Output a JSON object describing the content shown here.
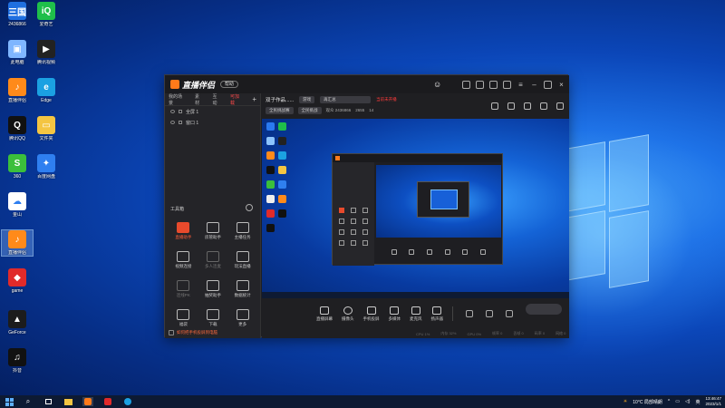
{
  "desktop": {
    "icons": [
      {
        "label": "2436866",
        "name": "desk-icon-app1",
        "color": "#1f6fe0",
        "glyph": "三国"
      },
      {
        "label": "爱奇艺",
        "name": "desk-icon-iqiyi",
        "color": "#1fbf4a",
        "glyph": "iQIYI"
      },
      {
        "label": "此电脑",
        "name": "desk-icon-computer",
        "color": "#7fb6ff",
        "glyph": "▣"
      },
      {
        "label": "腾讯视频",
        "name": "desk-icon-video",
        "color": "#222",
        "glyph": "▶"
      },
      {
        "label": "直播伴侣",
        "name": "desk-icon-live",
        "color": "#ff8a1a",
        "glyph": "♪"
      },
      {
        "label": "Edge",
        "name": "desk-icon-edge",
        "color": "#1ba1e2",
        "glyph": "e"
      },
      {
        "label": "腾讯QQ",
        "name": "desk-icon-qq",
        "color": "#111",
        "glyph": "Q"
      },
      {
        "label": "文件夹",
        "name": "desk-icon-folder",
        "color": "#f4c542",
        "glyph": "▭"
      },
      {
        "label": "360",
        "name": "desk-icon-360",
        "color": "#3bbf3b",
        "glyph": "S"
      },
      {
        "label": "百度网盘",
        "name": "desk-icon-baidu",
        "color": "#2f7ff0",
        "glyph": "✦"
      },
      {
        "label": "金山",
        "name": "desk-icon-cloud",
        "color": "#ffffff",
        "glyph": "☁"
      },
      {
        "label": "直播伴侣",
        "name": "desk-icon-live2",
        "color": "#ff8a1a",
        "glyph": "♪"
      },
      {
        "label": "game",
        "name": "desk-icon-game",
        "color": "#e02a2a",
        "glyph": "◆"
      },
      {
        "label": "GeForce",
        "name": "desk-icon-nvidia",
        "color": "#1c1c1c",
        "glyph": "▲"
      },
      {
        "label": "抖音",
        "name": "desk-icon-douyin",
        "color": "#111",
        "glyph": "♫"
      }
    ]
  },
  "app": {
    "title": "直播伴侣",
    "version": "帮助",
    "sidebar": {
      "tabs": [
        "我的场景",
        "素材",
        "互动",
        "可加载"
      ],
      "active_tab": 3,
      "scenes": [
        "全屏 1",
        "窗口 1"
      ],
      "tools_title": "工具箱",
      "tools": [
        {
          "label": "直播助手",
          "accent": true
        },
        {
          "label": "房管助手",
          "accent": false
        },
        {
          "label": "主播任务",
          "accent": false
        },
        {
          "label": "视频连接",
          "accent": false
        },
        {
          "label": "多人连麦",
          "accent": false,
          "dim": true
        },
        {
          "label": "玩法直播",
          "accent": false
        },
        {
          "label": "连线PK",
          "accent": false,
          "dim": true
        },
        {
          "label": "抽奖助手",
          "accent": false
        },
        {
          "label": "数据统计",
          "accent": false
        },
        {
          "label": "福袋",
          "accent": false
        },
        {
          "label": "下载",
          "accent": false
        },
        {
          "label": "更多",
          "accent": false
        }
      ],
      "footer": "如何把手机投屏到电脑"
    },
    "room": {
      "title": "双子作品......",
      "category": "游戏",
      "title_field": "再汇总",
      "warning": "当前未开播",
      "tag1": "全民挑战赛",
      "tag2": "全民挑战",
      "stats": [
        "观众 2436866",
        "2655",
        "14"
      ]
    },
    "bottom_bar": [
      {
        "label": "直播屏幕",
        "name": "screen-capture-button"
      },
      {
        "label": "摄像头",
        "name": "camera-button"
      },
      {
        "label": "手机投屏",
        "name": "phone-cast-button"
      },
      {
        "label": "多媒体",
        "name": "media-button"
      },
      {
        "label": "麦克风",
        "name": "microphone-button"
      },
      {
        "label": "扬声器",
        "name": "speaker-button"
      }
    ],
    "status": [
      "CPU 1%",
      "内存 32%",
      "GPU 0%",
      "帧率 0",
      "丢帧 0",
      "码率 0",
      "网络 0"
    ]
  },
  "taskbar": {
    "weather": "10°C 局部晴朗",
    "lang": "英",
    "time": "13:46:47",
    "date": "2023/1/1"
  }
}
